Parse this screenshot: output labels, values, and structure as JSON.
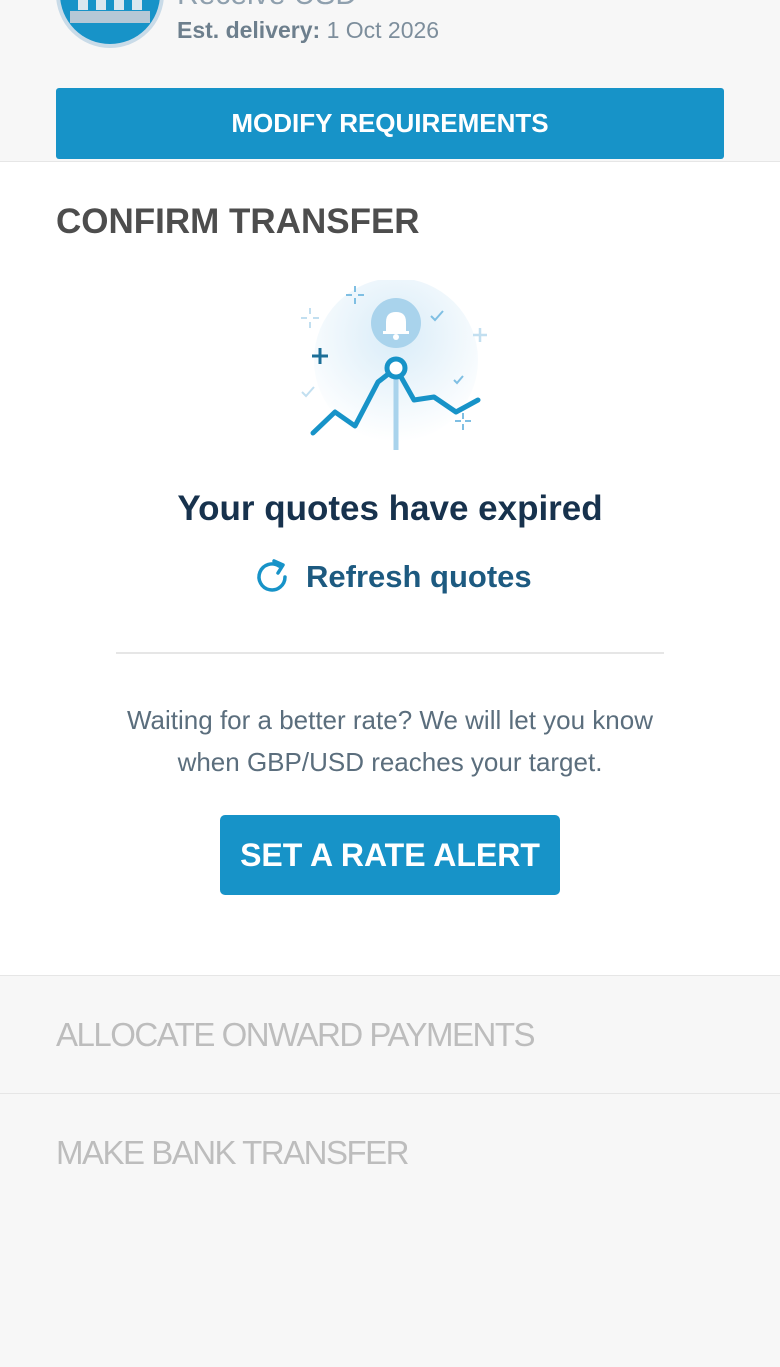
{
  "receive": {
    "title": "Receive USD",
    "delivery_label": "Est. delivery:",
    "delivery_date": "1 Oct 2026",
    "bank_icon": "bank-icon"
  },
  "modify_button": {
    "label": "MODIFY REQUIREMENTS"
  },
  "confirm": {
    "title": "CONFIRM TRANSFER",
    "illustration_icon": "rate-alert-chart-icon",
    "expired_message": "Your quotes have expired",
    "refresh_label": "Refresh quotes",
    "refresh_icon": "refresh-icon",
    "alert_text": "Waiting for a better rate? We will let you know when GBP/USD reaches your target.",
    "rate_alert_button": "SET A RATE ALERT"
  },
  "steps": [
    {
      "label": "ALLOCATE ONWARD PAYMENTS"
    },
    {
      "label": "MAKE BANK TRANSFER"
    }
  ],
  "colors": {
    "accent": "#1793c8",
    "heading": "#17324d",
    "link": "#1d5a80",
    "muted": "#bdbdbd",
    "background": "#f7f7f7"
  }
}
